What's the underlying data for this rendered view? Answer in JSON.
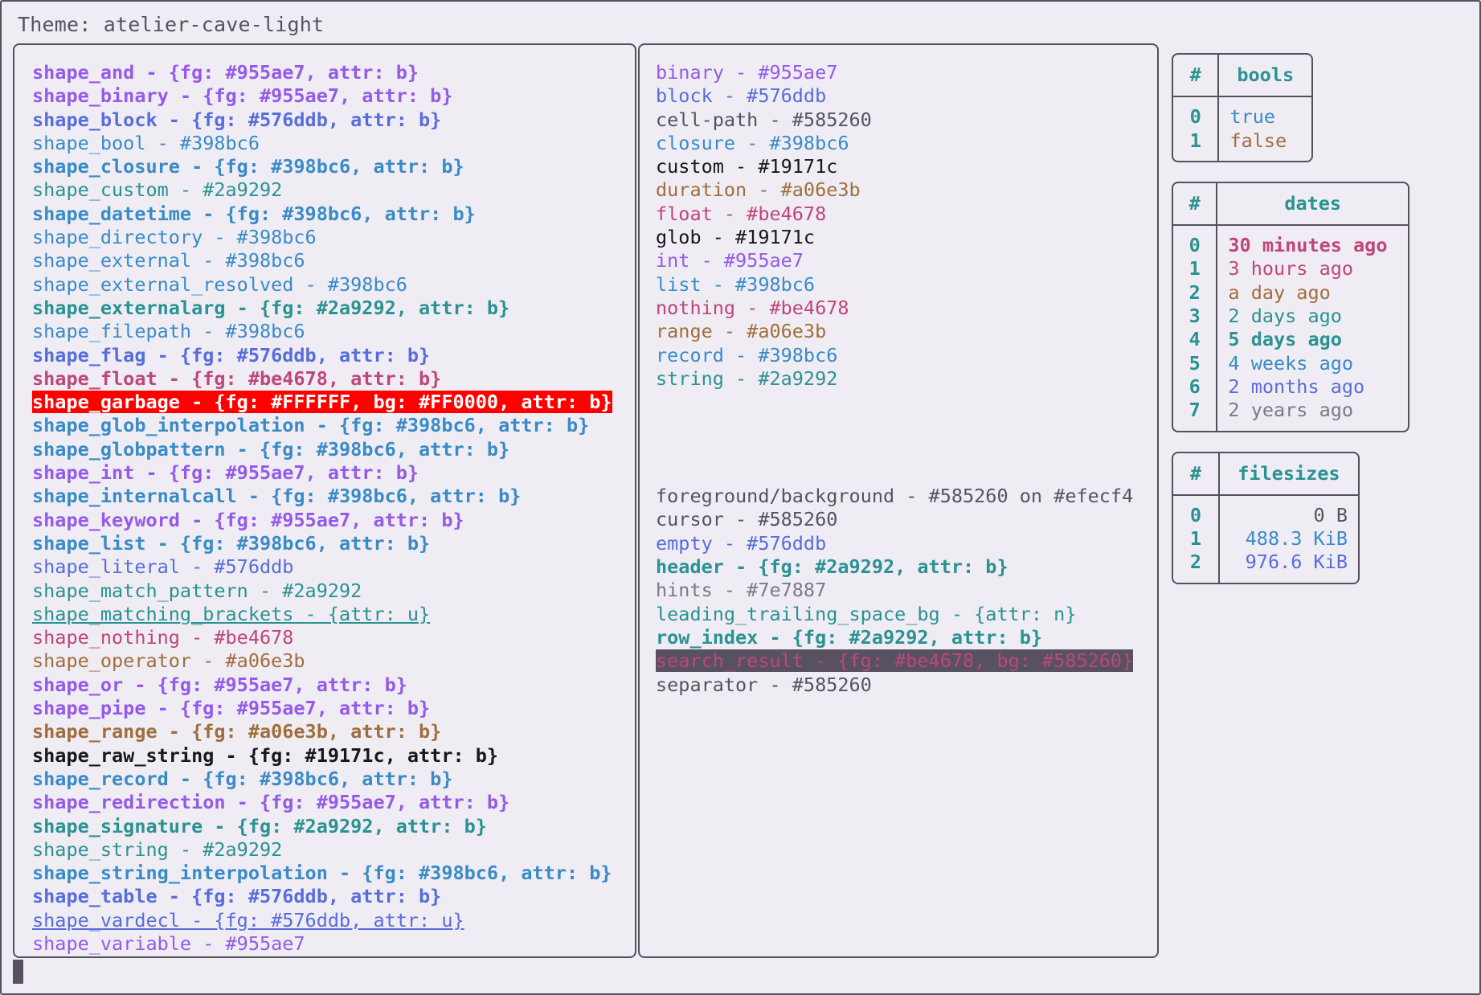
{
  "window": {
    "title": "Theme: atelier-cave-light"
  },
  "palette": {
    "background": "#efecf4",
    "foreground": "#585260",
    "purple": "#955ae7",
    "blue": "#576ddb",
    "cyan": "#398bc6",
    "teal": "#2a9292",
    "red": "#be4678",
    "orange": "#a06e3b",
    "black": "#19171c",
    "hints": "#7e7887",
    "garbage_fg": "#FFFFFF",
    "garbage_bg": "#FF0000",
    "search_fg": "#be4678",
    "search_bg": "#585260"
  },
  "shapes_pane": {
    "lines": [
      {
        "text": "shape_and - {fg: #955ae7, attr: b}",
        "style": "c-purple b"
      },
      {
        "text": "shape_binary - {fg: #955ae7, attr: b}",
        "style": "c-purple b"
      },
      {
        "text": "shape_block - {fg: #576ddb, attr: b}",
        "style": "c-blue b"
      },
      {
        "text": "shape_bool - #398bc6",
        "style": "c-cyan"
      },
      {
        "text": "shape_closure - {fg: #398bc6, attr: b}",
        "style": "c-cyan b"
      },
      {
        "text": "shape_custom - #2a9292",
        "style": "c-teal"
      },
      {
        "text": "shape_datetime - {fg: #398bc6, attr: b}",
        "style": "c-cyan b"
      },
      {
        "text": "shape_directory - #398bc6",
        "style": "c-cyan"
      },
      {
        "text": "shape_external - #398bc6",
        "style": "c-cyan"
      },
      {
        "text": "shape_external_resolved - #398bc6",
        "style": "c-cyan"
      },
      {
        "text": "shape_externalarg - {fg: #2a9292, attr: b}",
        "style": "c-teal b"
      },
      {
        "text": "shape_filepath - #398bc6",
        "style": "c-cyan"
      },
      {
        "text": "shape_flag - {fg: #576ddb, attr: b}",
        "style": "c-blue b"
      },
      {
        "text": "shape_float - {fg: #be4678, attr: b}",
        "style": "c-red b"
      },
      {
        "text": "shape_garbage - {fg: #FFFFFF, bg: #FF0000, attr: b}",
        "style": "hl-garbage"
      },
      {
        "text": "shape_glob_interpolation - {fg: #398bc6, attr: b}",
        "style": "c-cyan b"
      },
      {
        "text": "shape_globpattern - {fg: #398bc6, attr: b}",
        "style": "c-cyan b"
      },
      {
        "text": "shape_int - {fg: #955ae7, attr: b}",
        "style": "c-purple b"
      },
      {
        "text": "shape_internalcall - {fg: #398bc6, attr: b}",
        "style": "c-cyan b"
      },
      {
        "text": "shape_keyword - {fg: #955ae7, attr: b}",
        "style": "c-purple b"
      },
      {
        "text": "shape_list - {fg: #398bc6, attr: b}",
        "style": "c-cyan b"
      },
      {
        "text": "shape_literal - #576ddb",
        "style": "c-blue"
      },
      {
        "text": "shape_match_pattern - #2a9292",
        "style": "c-teal"
      },
      {
        "text": "shape_matching_brackets - {attr: u}",
        "style": "c-teal u"
      },
      {
        "text": "shape_nothing - #be4678",
        "style": "c-red"
      },
      {
        "text": "shape_operator - #a06e3b",
        "style": "c-orange"
      },
      {
        "text": "shape_or - {fg: #955ae7, attr: b}",
        "style": "c-purple b"
      },
      {
        "text": "shape_pipe - {fg: #955ae7, attr: b}",
        "style": "c-purple b"
      },
      {
        "text": "shape_range - {fg: #a06e3b, attr: b}",
        "style": "c-orange b"
      },
      {
        "text": "shape_raw_string - {fg: #19171c, attr: b}",
        "style": "c-black b"
      },
      {
        "text": "shape_record - {fg: #398bc6, attr: b}",
        "style": "c-cyan b"
      },
      {
        "text": "shape_redirection - {fg: #955ae7, attr: b}",
        "style": "c-purple b"
      },
      {
        "text": "shape_signature - {fg: #2a9292, attr: b}",
        "style": "c-teal b"
      },
      {
        "text": "shape_string - #2a9292",
        "style": "c-teal"
      },
      {
        "text": "shape_string_interpolation - {fg: #398bc6, attr: b}",
        "style": "c-cyan b"
      },
      {
        "text": "shape_table - {fg: #576ddb, attr: b}",
        "style": "c-blue b"
      },
      {
        "text": "shape_vardecl - {fg: #576ddb, attr: u}",
        "style": "c-blue u"
      },
      {
        "text": "shape_variable - #955ae7",
        "style": "c-purple"
      }
    ]
  },
  "types_pane": {
    "lines": [
      {
        "text": "binary - #955ae7",
        "style": "c-purple"
      },
      {
        "text": "block - #576ddb",
        "style": "c-blue"
      },
      {
        "text": "cell-path - #585260",
        "style": "c-grey"
      },
      {
        "text": "closure - #398bc6",
        "style": "c-cyan"
      },
      {
        "text": "custom - #19171c",
        "style": "c-black"
      },
      {
        "text": "duration - #a06e3b",
        "style": "c-orange"
      },
      {
        "text": "float - #be4678",
        "style": "c-red"
      },
      {
        "text": "glob - #19171c",
        "style": "c-black"
      },
      {
        "text": "int - #955ae7",
        "style": "c-purple"
      },
      {
        "text": "list - #398bc6",
        "style": "c-cyan"
      },
      {
        "text": "nothing - #be4678",
        "style": "c-red"
      },
      {
        "text": "range - #a06e3b",
        "style": "c-orange"
      },
      {
        "text": "record - #398bc6",
        "style": "c-cyan"
      },
      {
        "text": "string - #2a9292",
        "style": "c-teal"
      }
    ],
    "ui_lines": [
      {
        "text": "foreground/background - #585260 on #efecf4",
        "style": "c-grey"
      },
      {
        "text": "cursor - #585260",
        "style": "c-grey"
      },
      {
        "text": "empty - #576ddb",
        "style": "c-blue"
      },
      {
        "text": "header - {fg: #2a9292, attr: b}",
        "style": "c-teal b"
      },
      {
        "text": "hints - #7e7887",
        "style": "c-hint"
      },
      {
        "text": "leading_trailing_space_bg - {attr: n}",
        "style": "c-teal"
      },
      {
        "text": "row_index - {fg: #2a9292, attr: b}",
        "style": "c-teal b"
      },
      {
        "text": "search_result - {fg: #be4678, bg: #585260}",
        "style": "hl-search"
      },
      {
        "text": "separator - #585260",
        "style": "c-grey"
      }
    ]
  },
  "tables": {
    "bools": {
      "headers": [
        "#",
        "bools"
      ],
      "rows": [
        {
          "idx": "0",
          "value": "true",
          "style": "c-cyan"
        },
        {
          "idx": "1",
          "value": "false",
          "style": "c-orange"
        }
      ]
    },
    "dates": {
      "headers": [
        "#",
        "dates"
      ],
      "rows": [
        {
          "idx": "0",
          "value": "30 minutes ago",
          "style": "c-red b"
        },
        {
          "idx": "1",
          "value": "3 hours ago",
          "style": "c-red"
        },
        {
          "idx": "2",
          "value": "a day ago",
          "style": "c-orange"
        },
        {
          "idx": "3",
          "value": "2 days ago",
          "style": "c-teal"
        },
        {
          "idx": "4",
          "value": "5 days ago",
          "style": "c-teal b"
        },
        {
          "idx": "5",
          "value": "4 weeks ago",
          "style": "c-cyan"
        },
        {
          "idx": "6",
          "value": "2 months ago",
          "style": "c-blue"
        },
        {
          "idx": "7",
          "value": "2 years ago",
          "style": "c-hint"
        }
      ]
    },
    "filesizes": {
      "headers": [
        "#",
        "filesizes"
      ],
      "rows": [
        {
          "idx": "0",
          "value": "0 B",
          "style": "c-grey"
        },
        {
          "idx": "1",
          "value": "488.3 KiB",
          "style": "c-cyan"
        },
        {
          "idx": "2",
          "value": "976.6 KiB",
          "style": "c-blue"
        }
      ]
    }
  }
}
